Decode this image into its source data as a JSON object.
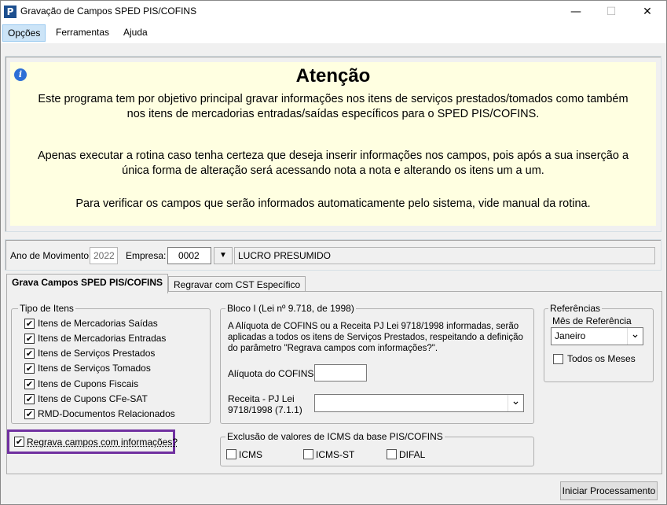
{
  "window": {
    "title": "Gravação de Campos SPED PIS/COFINS",
    "app_icon_glyph": "P",
    "minimize_glyph": "—",
    "maximize_glyph": "☐",
    "close_glyph": "✕"
  },
  "menu": {
    "items": [
      {
        "label": "Opções"
      },
      {
        "label": "Ferramentas"
      },
      {
        "label": "Ajuda"
      }
    ]
  },
  "attention": {
    "info_glyph": "i",
    "title": "Atenção",
    "para1_line1": "Este programa tem por objetivo principal gravar informações nos itens de serviços prestados/tomados como também",
    "para1_line2": "nos itens de mercadorias entradas/saídas específicos para o SPED PIS/COFINS.",
    "para2_line1": "Apenas executar a rotina caso tenha certeza que deseja inserir informações nos campos, pois após a sua inserção a",
    "para2_line2": "única forma de alteração será acessando nota a nota e alterando os itens um a um.",
    "para3": "Para verificar os campos que serão informados automaticamente pelo sistema, vide manual da rotina."
  },
  "header_fields": {
    "ano_label": "Ano de Movimento:",
    "ano_value": "2022",
    "empresa_label": "Empresa:",
    "empresa_value": "0002",
    "regime_value": "LUCRO PRESUMIDO",
    "dropdown_glyph": "▼"
  },
  "tabs": [
    {
      "label": "Grava Campos SPED PIS/COFINS"
    },
    {
      "label": "Regravar com CST Específico"
    }
  ],
  "tipo_itens": {
    "legend": "Tipo de Itens",
    "items": [
      {
        "label": "Itens de Mercadorias Saídas",
        "checked": true
      },
      {
        "label": "Itens de Mercadorias Entradas",
        "checked": true
      },
      {
        "label": "Itens de Serviços Prestados",
        "checked": true
      },
      {
        "label": "Itens de Serviços Tomados",
        "checked": true
      },
      {
        "label": "Itens de Cupons Fiscais",
        "checked": true
      },
      {
        "label": "Itens de Cupons CFe-SAT",
        "checked": true
      },
      {
        "label": "RMD-Documentos Relacionados",
        "checked": true
      }
    ],
    "check_glyph": "✔"
  },
  "regrava": {
    "label": "Regrava campos com informações?",
    "checked": true
  },
  "bloco_i": {
    "legend": "Bloco I (Lei nº 9.718, de 1998)",
    "desc_line1": "A Alíquota de COFINS ou a Receita PJ Lei 9718/1998 informadas, serão",
    "desc_line2": "aplicadas a todos os itens de Serviços Prestados, respeitando a definição",
    "desc_line3": "do parâmetro \"Regrava campos com informações?\".",
    "aliquota_label": "Alíquota do COFINS",
    "aliquota_value": "",
    "receita_label_line1": "Receita - PJ Lei",
    "receita_label_line2": "9718/1998 (7.1.1)",
    "receita_value": "",
    "chevron_glyph": "⌄"
  },
  "exclusao": {
    "legend": "Exclusão de valores de ICMS da base PIS/COFINS",
    "items": [
      {
        "label": "ICMS",
        "checked": false
      },
      {
        "label": "ICMS-ST",
        "checked": false
      },
      {
        "label": "DIFAL",
        "checked": false
      }
    ]
  },
  "referencias": {
    "legend": "Referências",
    "mes_label": "Mês de Referência",
    "mes_value": "Janeiro",
    "todos_label": "Todos os Meses",
    "todos_checked": false,
    "chevron_glyph": "⌄"
  },
  "footer": {
    "start_button": "Iniciar Processamento"
  }
}
